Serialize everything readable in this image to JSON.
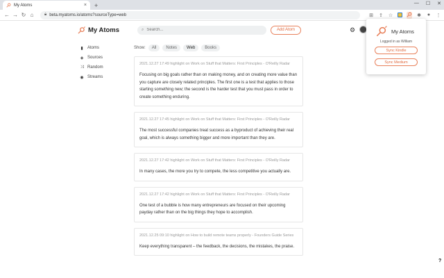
{
  "browser": {
    "tab_title": "My Atoms",
    "tab_close": "×",
    "new_tab": "+",
    "url": "beta.myatoms.io/atoms?sourceType=web",
    "win_min": "—",
    "win_max": "☐",
    "win_close": "✕"
  },
  "app": {
    "brand": "My Atoms",
    "search_placeholder": "Search...",
    "add_atom": "Add Atom",
    "accent": "#e8805a"
  },
  "sidebar": {
    "items": [
      {
        "label": "Atoms",
        "icon": "book-icon"
      },
      {
        "label": "Sources",
        "icon": "layers-icon"
      },
      {
        "label": "Random",
        "icon": "shuffle-icon"
      },
      {
        "label": "Streams",
        "icon": "stream-icon"
      }
    ]
  },
  "filters": {
    "show_label": "Show:",
    "options": [
      "All",
      "Notes",
      "Web",
      "Books"
    ],
    "active": "Web"
  },
  "cards": [
    {
      "meta": "2021.12.27 17:49 highlight on Work on Stuff that Matters: First Principles - O'Reilly Radar",
      "body": "Focusing on big goals rather than on making money, and on creating more value than you capture are closely related principles. The first one is a test that applies to those starting something new; the second is the harder test that you must pass in order to create something enduring."
    },
    {
      "meta": "2021.12.27 17:45 highlight on Work on Stuff that Matters: First Principles - O'Reilly Radar",
      "body": "The most successful companies treat success as a byproduct of achieving their real goal, which is always something bigger and more important than they are."
    },
    {
      "meta": "2021.12.27 17:42 highlight on Work on Stuff that Matters: First Principles - O'Reilly Radar",
      "body": "In many cases, the more you try to compete, the less competitive you actually are."
    },
    {
      "meta": "2021.12.27 17:42 highlight on Work on Stuff that Matters: First Principles - O'Reilly Radar",
      "body": "One test of a bubble is how many entrepreneurs are focused on their upcoming payday rather than on the big things they hope to accomplish."
    },
    {
      "meta": "2021.12.25 09:10 highlight on How to build remote teams properly - Founders Guide Series",
      "body": "Keep everything transparent – the feedback, the decisions, the mistakes, the praise."
    }
  ],
  "popup": {
    "title": "My Atoms",
    "logged_in": "Logged in as William",
    "sync_kindle": "Sync Kindle",
    "sync_medium": "Sync Medium"
  },
  "help": "?"
}
